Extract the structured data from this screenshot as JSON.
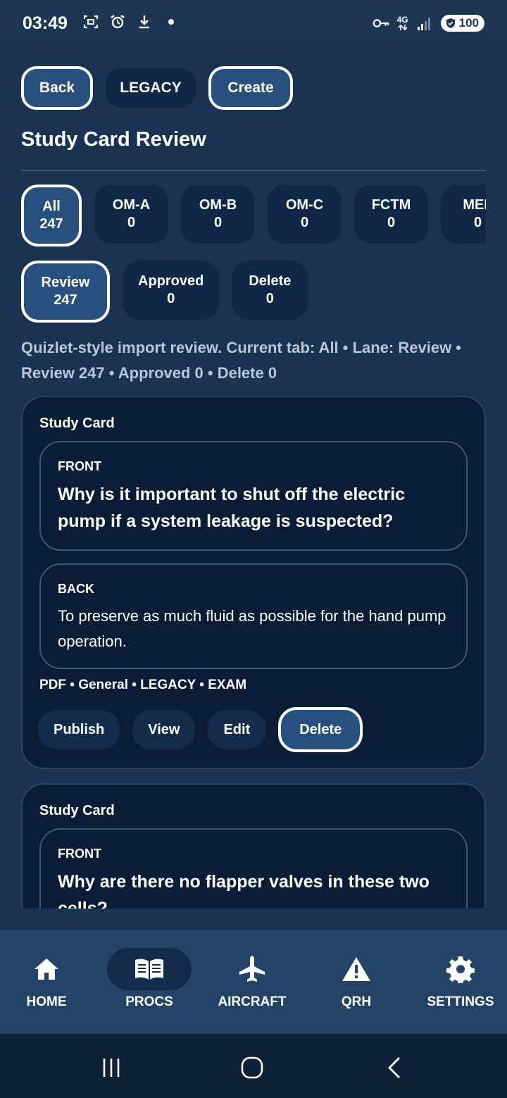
{
  "status_bar": {
    "time": "03:49",
    "network": "4G",
    "battery": "100",
    "colors": {
      "background": "#1c3654",
      "text": "#ffffff"
    }
  },
  "header": {
    "back_label": "Back",
    "legacy_label": "LEGACY",
    "create_label": "Create",
    "title": "Study Card Review"
  },
  "category_tabs": [
    {
      "label": "All",
      "count": "247"
    },
    {
      "label": "OM-A",
      "count": "0"
    },
    {
      "label": "OM-B",
      "count": "0"
    },
    {
      "label": "OM-C",
      "count": "0"
    },
    {
      "label": "FCTM",
      "count": "0"
    },
    {
      "label": "MEL",
      "count": "0"
    }
  ],
  "lane_tabs": [
    {
      "label": "Review",
      "count": "247"
    },
    {
      "label": "Approved",
      "count": "0"
    },
    {
      "label": "Delete",
      "count": "0"
    }
  ],
  "summary": "Quizlet-style import review. Current tab: All • Lane: Review • Review 247 • Approved 0 • Delete 0",
  "cards": [
    {
      "label": "Study Card",
      "front_label": "FRONT",
      "front": "Why is it important to shut off the electric pump if a system leakage is suspected?",
      "back_label": "BACK",
      "back": "To preserve as much fluid as possible for the hand pump operation.",
      "meta": "PDF • General • LEGACY • EXAM",
      "actions": {
        "publish": "Publish",
        "view": "View",
        "edit": "Edit",
        "delete": "Delete"
      }
    },
    {
      "label": "Study Card",
      "front_label": "FRONT",
      "front": "Why are there no flapper valves in these two cells?"
    }
  ],
  "bottom_nav": [
    {
      "label": "HOME",
      "icon": "home-icon"
    },
    {
      "label": "PROCS",
      "icon": "book-icon"
    },
    {
      "label": "AIRCRAFT",
      "icon": "airplane-icon"
    },
    {
      "label": "QRH",
      "icon": "warning-icon"
    },
    {
      "label": "SETTINGS",
      "icon": "gear-icon"
    }
  ],
  "theme": {
    "background": "#1a3352",
    "surface": "#102847",
    "card": "#0a1c36",
    "active": "#27507f",
    "muted_text": "#b9c7d8"
  }
}
